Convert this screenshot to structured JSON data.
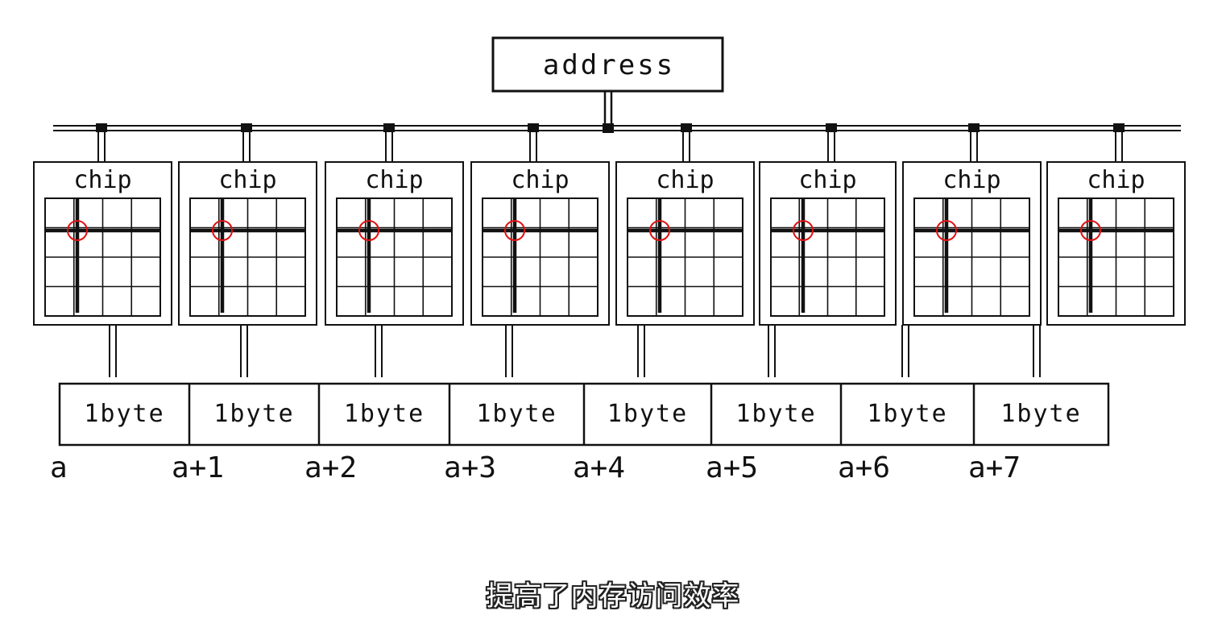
{
  "diagram": {
    "address_label": "address",
    "chips": [
      {
        "label": "chip"
      },
      {
        "label": "chip"
      },
      {
        "label": "chip"
      },
      {
        "label": "chip"
      },
      {
        "label": "chip"
      },
      {
        "label": "chip"
      },
      {
        "label": "chip"
      },
      {
        "label": "chip"
      }
    ],
    "bytes": [
      {
        "label": "1byte",
        "address": "a"
      },
      {
        "label": "1byte",
        "address": "a+1"
      },
      {
        "label": "1byte",
        "address": "a+2"
      },
      {
        "label": "1byte",
        "address": "a+3"
      },
      {
        "label": "1byte",
        "address": "a+4"
      },
      {
        "label": "1byte",
        "address": "a+5"
      },
      {
        "label": "1byte",
        "address": "a+6"
      },
      {
        "label": "1byte",
        "address": "a+7"
      }
    ],
    "highlight_color": "#e01010",
    "line_color": "#111111"
  },
  "subtitle": "提高了内存访问效率"
}
